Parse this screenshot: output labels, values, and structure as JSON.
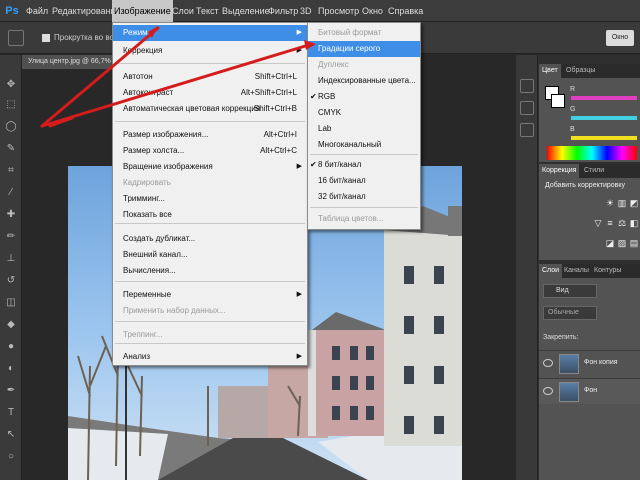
{
  "menubar": {
    "logo": "Ps",
    "items": [
      "Файл",
      "Редактирование",
      "Изображение",
      "Слои",
      "Текст",
      "Выделение",
      "Фильтр",
      "3D",
      "Просмотр",
      "Окно",
      "Справка"
    ],
    "active_index": 2
  },
  "options_bar": {
    "checkbox_label": "Прокрутка во всех окнах",
    "right_button": "Окно"
  },
  "document": {
    "tab_label": "Улица центр.jpg @ 66,7%"
  },
  "image_menu": {
    "items": [
      {
        "label": "Режим",
        "shortcut": "",
        "submenu": true,
        "highlight": true,
        "disabled": false
      },
      {
        "label": "Коррекция",
        "shortcut": "",
        "submenu": true,
        "highlight": false,
        "disabled": false
      },
      {
        "label": "Автотон",
        "shortcut": "Shift+Ctrl+L",
        "submenu": false,
        "highlight": false,
        "disabled": false
      },
      {
        "label": "Автоконтраст",
        "shortcut": "Alt+Shift+Ctrl+L",
        "submenu": false,
        "highlight": false,
        "disabled": false
      },
      {
        "label": "Автоматическая цветовая коррекция",
        "shortcut": "Shift+Ctrl+B",
        "submenu": false,
        "highlight": false,
        "disabled": false
      },
      {
        "label": "Размер изображения...",
        "shortcut": "Alt+Ctrl+I",
        "submenu": false,
        "highlight": false,
        "disabled": false
      },
      {
        "label": "Размер холста...",
        "shortcut": "Alt+Ctrl+C",
        "submenu": false,
        "highlight": false,
        "disabled": false
      },
      {
        "label": "Вращение изображения",
        "shortcut": "",
        "submenu": true,
        "highlight": false,
        "disabled": false
      },
      {
        "label": "Кадрировать",
        "shortcut": "",
        "submenu": false,
        "highlight": false,
        "disabled": true
      },
      {
        "label": "Тримминг...",
        "shortcut": "",
        "submenu": false,
        "highlight": false,
        "disabled": false
      },
      {
        "label": "Показать все",
        "shortcut": "",
        "submenu": false,
        "highlight": false,
        "disabled": false
      },
      {
        "label": "Создать дубликат...",
        "shortcut": "",
        "submenu": false,
        "highlight": false,
        "disabled": false
      },
      {
        "label": "Внешний канал...",
        "shortcut": "",
        "submenu": false,
        "highlight": false,
        "disabled": false
      },
      {
        "label": "Вычисления...",
        "shortcut": "",
        "submenu": false,
        "highlight": false,
        "disabled": false
      },
      {
        "label": "Переменные",
        "shortcut": "",
        "submenu": true,
        "highlight": false,
        "disabled": false
      },
      {
        "label": "Применить набор данных...",
        "shortcut": "",
        "submenu": false,
        "highlight": false,
        "disabled": true
      },
      {
        "label": "Треппинг...",
        "shortcut": "",
        "submenu": false,
        "highlight": false,
        "disabled": true
      },
      {
        "label": "Анализ",
        "shortcut": "",
        "submenu": true,
        "highlight": false,
        "disabled": false
      }
    ]
  },
  "mode_submenu": {
    "items": [
      {
        "label": "Битовый формат",
        "checked": false,
        "highlight": false,
        "disabled": true
      },
      {
        "label": "Градации серого",
        "checked": false,
        "highlight": true,
        "disabled": false
      },
      {
        "label": "Дуплекс",
        "checked": false,
        "highlight": false,
        "disabled": true
      },
      {
        "label": "Индексированные цвета...",
        "checked": false,
        "highlight": false,
        "disabled": false
      },
      {
        "label": "RGB",
        "checked": true,
        "highlight": false,
        "disabled": false
      },
      {
        "label": "CMYK",
        "checked": false,
        "highlight": false,
        "disabled": false
      },
      {
        "label": "Lab",
        "checked": false,
        "highlight": false,
        "disabled": false
      },
      {
        "label": "Многоканальный",
        "checked": false,
        "highlight": false,
        "disabled": false
      },
      {
        "label": "8 бит/канал",
        "checked": true,
        "highlight": false,
        "disabled": false
      },
      {
        "label": "16 бит/канал",
        "checked": false,
        "highlight": false,
        "disabled": false
      },
      {
        "label": "32 бит/канал",
        "checked": false,
        "highlight": false,
        "disabled": false
      },
      {
        "label": "Таблица цветов...",
        "checked": false,
        "highlight": false,
        "disabled": true
      }
    ]
  },
  "color_panel": {
    "tabs": [
      "Цвет",
      "Образцы"
    ],
    "channels": [
      "R",
      "G",
      "B"
    ],
    "colors": {
      "r": "#e040c0",
      "g": "#40d0e0",
      "b": "#f0e020"
    }
  },
  "adjustments_panel": {
    "tabs": [
      "Коррекция",
      "Стили"
    ],
    "title": "Добавить корректировку"
  },
  "layers_panel": {
    "tabs": [
      "Слои",
      "Каналы",
      "Контуры"
    ],
    "filter_label": "Вид",
    "blend_mode": "Обычные",
    "lock_label": "Закрепить:",
    "layers": [
      {
        "name": "Фон копия"
      },
      {
        "name": "Фон"
      }
    ]
  },
  "annotation_color": "#d41c1c"
}
